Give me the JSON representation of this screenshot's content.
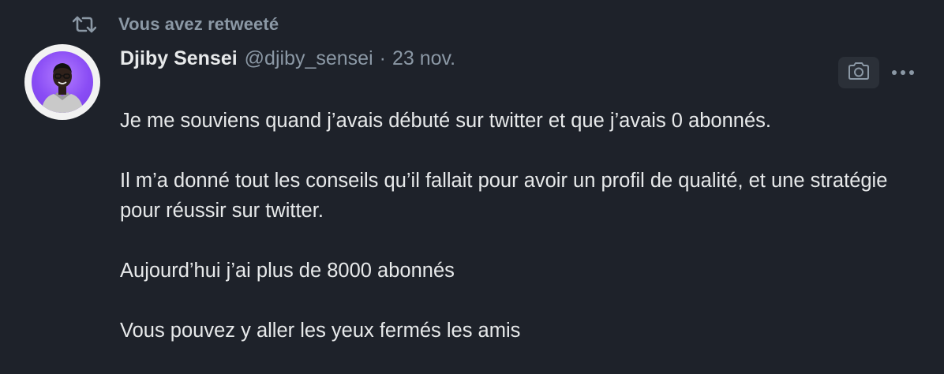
{
  "retweet": {
    "icon": "retweet-icon",
    "label": "Vous avez retweeté"
  },
  "author": {
    "display_name": "Djiby Sensei",
    "handle": "@djiby_sensei",
    "separator": "·",
    "date": "23 nov.",
    "avatar_icon": "avatar-photo"
  },
  "actions": {
    "camera_icon": "camera-icon",
    "more_icon": "more-icon"
  },
  "tweet": {
    "paragraphs": [
      "Je me souviens quand j’avais débuté sur twitter et que j’avais 0 abonnés.",
      "Il m’a donné tout les conseils qu’il fallait pour avoir un profil de qualité, et une stratégie pour réussir sur twitter.",
      "Aujourd’hui j’ai plus de 8000 abonnés",
      "Vous pouvez y aller les yeux fermés les amis"
    ]
  },
  "colors": {
    "background": "#1e222a",
    "text_primary": "#e7e9ea",
    "text_secondary": "#8b98a5",
    "avatar_accent": "#8a4df5"
  }
}
